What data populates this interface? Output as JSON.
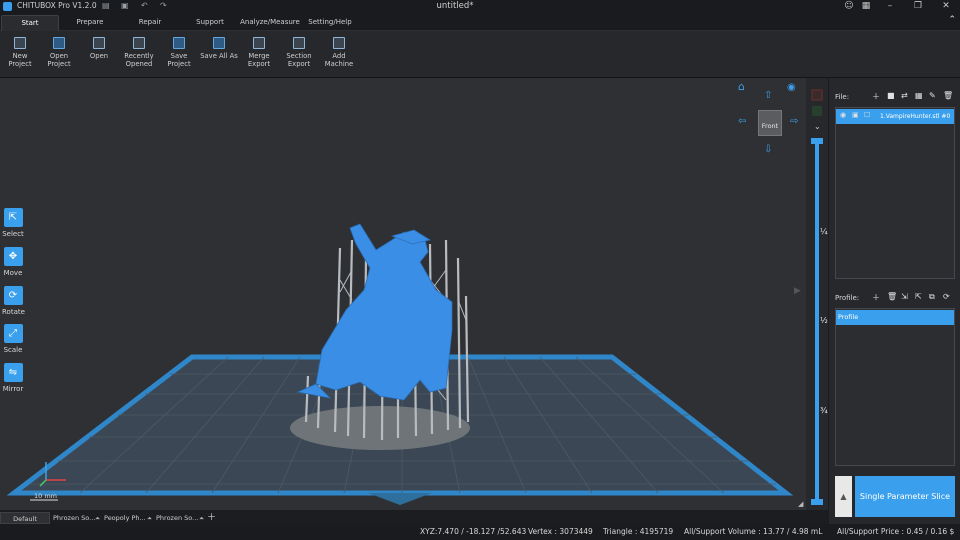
{
  "app": {
    "name": "CHITUBOX Pro V1.2.0",
    "document_title": "untitled*"
  },
  "title_icons": [
    "save-icon",
    "save-all-icon",
    "undo-icon",
    "redo-icon"
  ],
  "window_controls": [
    "account-icon",
    "layout-icon",
    "minimize-icon",
    "restore-icon",
    "close-icon"
  ],
  "menu": {
    "tabs": [
      {
        "label": "Start",
        "active": true
      },
      {
        "label": "Prepare"
      },
      {
        "label": "Repair"
      },
      {
        "label": "Support"
      },
      {
        "label": "Analyze/Measure"
      },
      {
        "label": "Setting/Help"
      }
    ],
    "collapse_glyph": "⌃"
  },
  "ribbon": {
    "buttons": [
      {
        "label": "New Project",
        "icon": "new-project-icon"
      },
      {
        "label": "Open\nProject",
        "icon": "open-project-icon"
      },
      {
        "label": "Open",
        "icon": "open-icon"
      },
      {
        "label": "Recently\nOpened",
        "icon": "recent-icon"
      },
      {
        "label": "Save Project",
        "icon": "save-project-icon"
      },
      {
        "label": "Save All As",
        "icon": "save-all-as-icon"
      },
      {
        "label": "Merge\nExport",
        "icon": "merge-export-icon"
      },
      {
        "label": "Section\nExport",
        "icon": "section-export-icon"
      },
      {
        "label": "Add\nMachine",
        "icon": "add-machine-icon"
      }
    ]
  },
  "tools": [
    {
      "label": "Select",
      "icon": "cursor-icon",
      "glyph": "⇱"
    },
    {
      "label": "Move",
      "icon": "move-icon",
      "glyph": "✥"
    },
    {
      "label": "Rotate",
      "icon": "rotate-icon",
      "glyph": "⟳"
    },
    {
      "label": "Scale",
      "icon": "scale-icon",
      "glyph": "⤢"
    },
    {
      "label": "Mirror",
      "icon": "mirror-icon",
      "glyph": "⇋"
    }
  ],
  "view_cube": {
    "face": "Front"
  },
  "scale_bar": {
    "label": "10 mm"
  },
  "layer_slider": {
    "marks": [
      "¼",
      "½",
      "¾"
    ]
  },
  "file_panel": {
    "label": "File:",
    "icons": [
      "add-icon",
      "square-icon",
      "swap-icon",
      "grid-icon",
      "edit-icon",
      "delete-icon"
    ],
    "item": "1.VampireHunter.stl #0"
  },
  "profile_panel": {
    "label": "Profile:",
    "icons": [
      "add-icon",
      "delete-icon",
      "import-icon",
      "export-icon",
      "copy-icon",
      "refresh-icon"
    ],
    "item": "Profile"
  },
  "slice": {
    "label": "Single Parameter Slice",
    "arrow": "▲"
  },
  "bottom_tabs": [
    "Default",
    "Phrozen So...",
    "Peopoly Ph...",
    "Phrozen So..."
  ],
  "status": {
    "xyz": "XYZ:7.470 / -18.127 /52.643",
    "vertex": "Vertex : 3073449",
    "triangle": "Triangle : 4195719",
    "volume": "All/Support Volume : 13.77 / 4.98 mL",
    "price": "All/Support Price : 0.45 / 0.16 $"
  },
  "colors": {
    "accent": "#3aa0ee",
    "model": "#3a8ee6",
    "support": "#b8bcc0",
    "plate": "#2e6f9e"
  }
}
